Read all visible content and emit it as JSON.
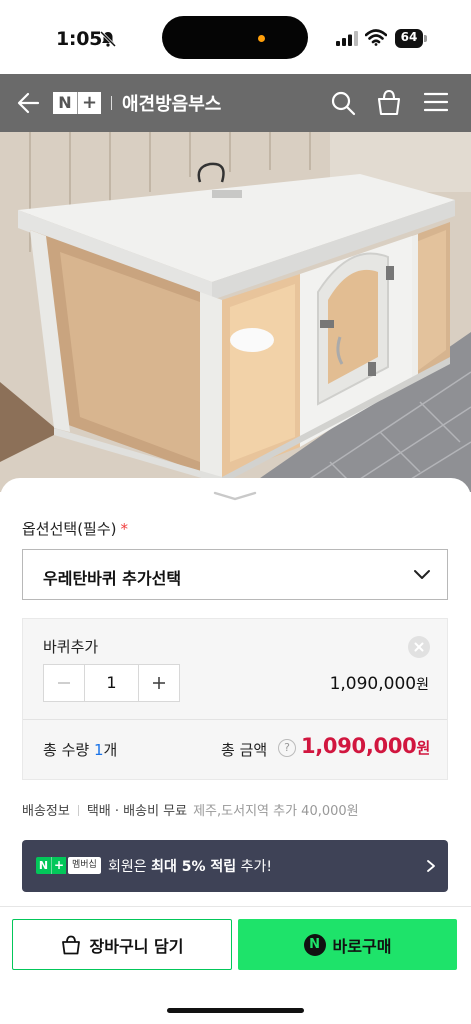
{
  "status_bar": {
    "time": "1:05",
    "battery": "64",
    "icons": [
      "bell-slash-icon",
      "signal-icon",
      "wifi-icon",
      "battery-icon"
    ]
  },
  "header": {
    "logo_n": "N",
    "logo_plus": "+",
    "title": "애견방음부스",
    "icons": [
      "back-arrow-icon",
      "search-icon",
      "shopping-bag-icon",
      "menu-icon"
    ]
  },
  "product_image": {
    "description_icon": "product-photo"
  },
  "option": {
    "title": "옵션선택(필수)",
    "required_mark": "*",
    "selected": "우레탄바퀴 추가선택"
  },
  "selected_item": {
    "name": "바퀴추가",
    "quantity": "1",
    "minus": "−",
    "plus": "+",
    "price": "1,090,000",
    "price_unit": "원"
  },
  "totals": {
    "qty_label": "총 수량 ",
    "qty_value": "1",
    "qty_unit": "개",
    "amount_label": "총 금액",
    "help": "?",
    "amount": "1,090,000",
    "amount_unit": "원"
  },
  "shipping": {
    "label": "배송정보",
    "method": "택배 · 배송비 무료",
    "extra": "제주,도서지역 추가 40,000원"
  },
  "membership": {
    "badge_n": "N",
    "badge_plus": "+",
    "badge_text": "멤버십",
    "text_before": "회원은 ",
    "text_bold": "최대 5% 적립",
    "text_after": " 추가!"
  },
  "actions": {
    "cart_label": "장바구니 담기",
    "buy_badge": "N",
    "buy_label": "바로구매"
  },
  "colors": {
    "header_bg": "#6a6a6a",
    "accent_green": "#1ee36a",
    "price_red": "#d1163f",
    "membership_bg": "#3e4256"
  }
}
